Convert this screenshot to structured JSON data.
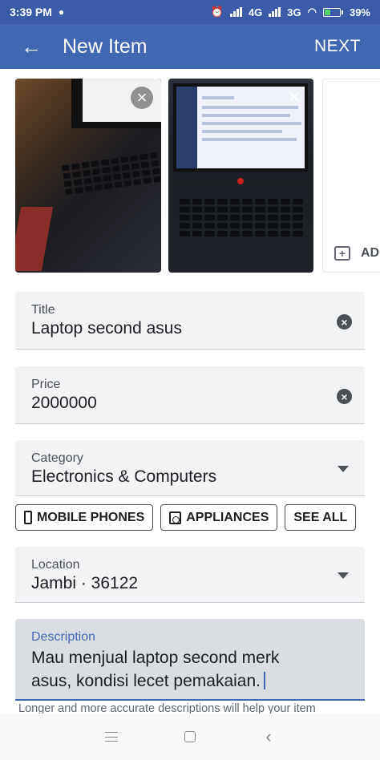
{
  "status": {
    "time": "3:39 PM",
    "net1": "4G",
    "net2": "3G",
    "battery": "39%",
    "battery_level": 0.39
  },
  "appbar": {
    "title": "New Item",
    "next_label": "NEXT"
  },
  "photos": {
    "add_label": "ADD"
  },
  "title_field": {
    "label": "Title",
    "value": "Laptop second asus"
  },
  "price_field": {
    "label": "Price",
    "value": "2000000"
  },
  "category_field": {
    "label": "Category",
    "value": "Electronics & Computers"
  },
  "category_chips": {
    "mobile_phones": "MOBILE PHONES",
    "appliances": "APPLIANCES",
    "see_all": "SEE ALL"
  },
  "location_field": {
    "label": "Location",
    "value": "Jambi · 36122"
  },
  "description_field": {
    "label": "Description",
    "value": "Mau menjual laptop second merk asus, kondisi lecet pemakaian.",
    "helper": "Longer and more accurate descriptions will help your item"
  },
  "colors": {
    "brand": "#4267b2",
    "statusbar": "#3b5ba8",
    "field_bg": "#f2f3f5"
  }
}
